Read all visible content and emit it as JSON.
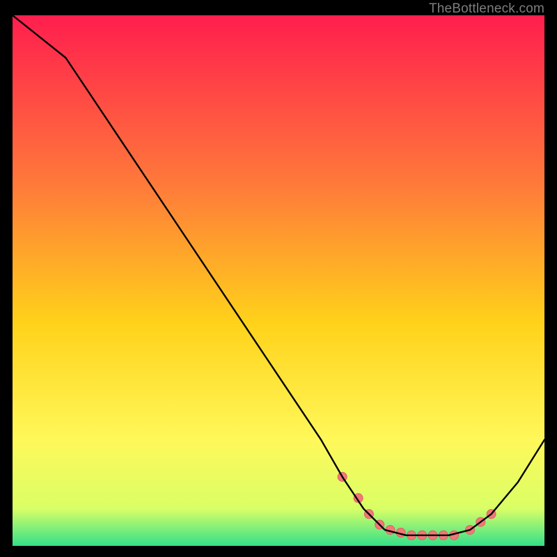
{
  "attribution": "TheBottleneck.com",
  "colors": {
    "top": "#ff1e4e",
    "mid_upper": "#ff7a3a",
    "mid": "#ffd21a",
    "mid_lower": "#fff85a",
    "near_bottom": "#d9ff66",
    "bottom": "#33e08a",
    "curve": "#000000",
    "marker_fill": "#f07878",
    "marker_stroke": "#e06060"
  },
  "chart_data": {
    "type": "line",
    "title": "",
    "xlabel": "",
    "ylabel": "",
    "xlim": [
      0,
      100
    ],
    "ylim": [
      0,
      100
    ],
    "grid": false,
    "series": [
      {
        "name": "bottleneck-curve",
        "x": [
          0,
          10,
          20,
          30,
          40,
          50,
          58,
          62,
          66,
          70,
          74,
          78,
          82,
          86,
          90,
          95,
          100
        ],
        "y": [
          100,
          92,
          77,
          62,
          47,
          32,
          20,
          13,
          7,
          3,
          2,
          2,
          2,
          3,
          6,
          12,
          20
        ]
      }
    ],
    "markers": {
      "name": "highlight-points",
      "x": [
        62,
        65,
        67,
        69,
        71,
        73,
        75,
        77,
        79,
        81,
        83,
        86,
        88,
        90
      ],
      "y": [
        13,
        9,
        6,
        4,
        3,
        2.5,
        2,
        2,
        2,
        2,
        2,
        3,
        4.5,
        6
      ]
    }
  }
}
